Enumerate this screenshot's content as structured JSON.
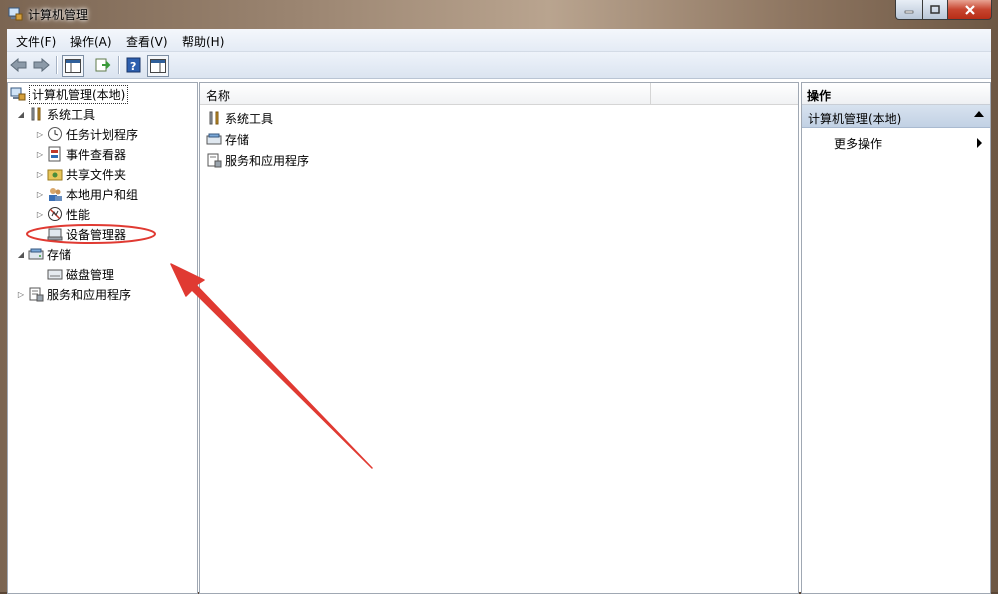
{
  "window": {
    "title": "计算机管理",
    "icon": "computer-management-icon"
  },
  "menu": [
    "文件(F)",
    "操作(A)",
    "查看(V)",
    "帮助(H)"
  ],
  "toolbar": {
    "buttons": [
      "back-arrow-icon",
      "forward-arrow-icon",
      "show-hide-tree-icon",
      "export-list-icon",
      "help-icon",
      "show-hide-action-pane-icon"
    ]
  },
  "tree": {
    "root": "计算机管理(本地)",
    "system_tools": "系统工具",
    "task_scheduler": "任务计划程序",
    "event_viewer": "事件查看器",
    "shared_folders": "共享文件夹",
    "local_users_groups": "本地用户和组",
    "performance": "性能",
    "device_manager": "设备管理器",
    "storage": "存储",
    "disk_management": "磁盘管理",
    "services_apps": "服务和应用程序"
  },
  "list": {
    "column_name": "名称",
    "items": [
      "系统工具",
      "存储",
      "服务和应用程序"
    ]
  },
  "actions": {
    "header": "操作",
    "section": "计算机管理(本地)",
    "more": "更多操作"
  },
  "annotation_color": "#e03a32"
}
